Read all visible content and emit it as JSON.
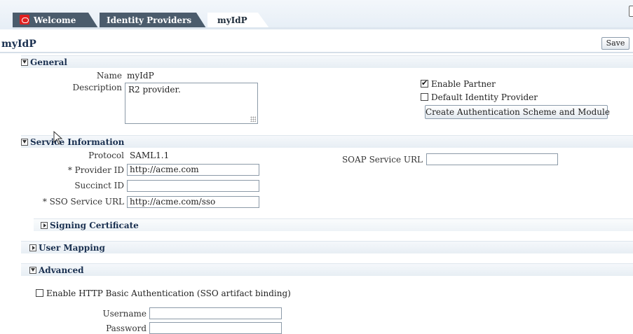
{
  "tabs": [
    {
      "label": "Welcome"
    },
    {
      "label": "Identity Providers"
    },
    {
      "label": "myIdP"
    }
  ],
  "page": {
    "title": "myIdP",
    "save_label": "Save"
  },
  "general": {
    "header": "General",
    "name_label": "Name",
    "name_value": "myIdP",
    "description_label": "Description",
    "description_value": "R2 provider.",
    "enable_partner_label": "Enable Partner",
    "enable_partner_checked": true,
    "default_idp_label": "Default Identity Provider",
    "default_idp_checked": false,
    "create_auth_button": "Create Authentication Scheme and Module"
  },
  "service": {
    "header": "Service Information",
    "protocol_label": "Protocol",
    "protocol_value": "SAML1.1",
    "provider_id_label": "* Provider ID",
    "provider_id_value": "http://acme.com",
    "succinct_id_label": "Succinct ID",
    "succinct_id_value": "",
    "sso_url_label": "* SSO Service URL",
    "sso_url_value": "http://acme.com/sso",
    "soap_url_label": "SOAP Service URL",
    "soap_url_value": ""
  },
  "signing": {
    "header": "Signing Certificate"
  },
  "user_mapping": {
    "header": "User Mapping"
  },
  "advanced": {
    "header": "Advanced",
    "http_basic_label": "Enable HTTP Basic Authentication (SSO artifact binding)",
    "http_basic_checked": false,
    "username_label": "Username",
    "username_value": "",
    "password_label": "Password",
    "password_value": ""
  },
  "icons": {
    "logo": "oracle-logo-icon",
    "expand": "chevron-down-icon",
    "collapse": "chevron-right-icon",
    "cursor": "mouse-pointer-icon"
  },
  "colors": {
    "tab_dark": "#4b5c6c",
    "title": "#1a3050",
    "section_bg": "#e7eef4",
    "logo_red": "#e02020"
  }
}
